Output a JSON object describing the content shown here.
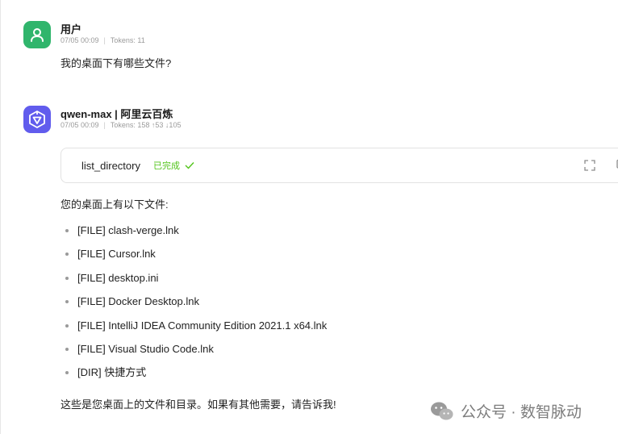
{
  "user_message": {
    "sender": "用户",
    "timestamp": "07/05 00:09",
    "tokens": "Tokens: 11",
    "text": "我的桌面下有哪些文件?"
  },
  "bot_message": {
    "sender": "qwen-max | 阿里云百炼",
    "timestamp": "07/05 00:09",
    "tokens": "Tokens: 158 ↑53 ↓105",
    "tool_call": {
      "name": "list_directory",
      "status": "已完成"
    },
    "intro": "您的桌面上有以下文件:",
    "files": [
      "[FILE] clash-verge.lnk",
      "[FILE] Cursor.lnk",
      "[FILE] desktop.ini",
      "[FILE] Docker Desktop.lnk",
      "[FILE] IntelliJ IDEA Community Edition 2021.1 x64.lnk",
      "[FILE] Visual Studio Code.lnk",
      "[DIR] 快捷方式"
    ],
    "outro": "这些是您桌面上的文件和目录。如果有其他需要，请告诉我!"
  },
  "watermark": {
    "text": "公众号 · 数智脉动",
    "icon": "wechat-icon"
  },
  "colors": {
    "user_avatar": "#30b56c",
    "bot_avatar": "#615ced",
    "status_done": "#52c41a"
  }
}
